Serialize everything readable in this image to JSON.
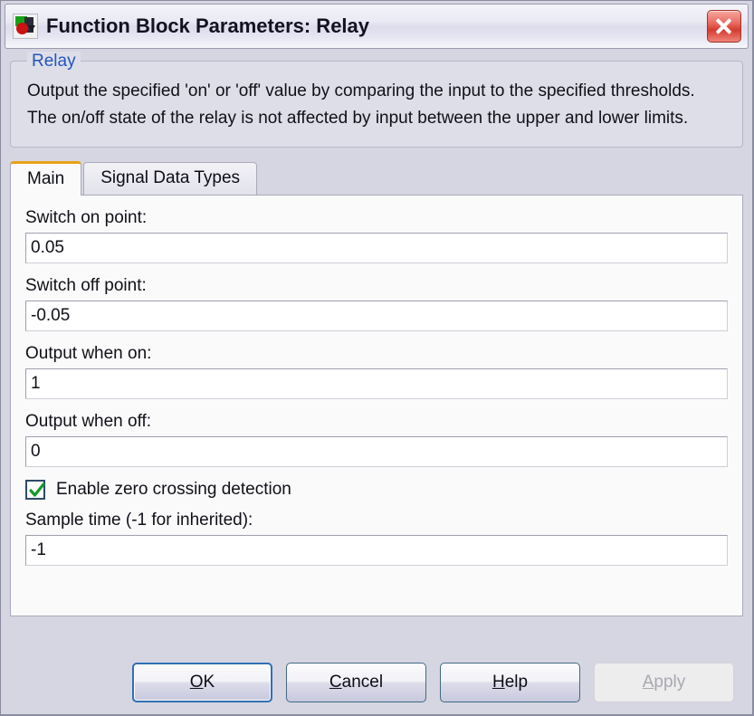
{
  "window": {
    "title": "Function Block Parameters: Relay",
    "icon": "simulink-block-icon",
    "close_label": "close-icon"
  },
  "description_group": {
    "label": "Relay",
    "text": "Output the specified 'on' or 'off' value by comparing the input to the specified thresholds.  The on/off state of the relay is not affected by input between the upper and lower limits."
  },
  "tabs": [
    {
      "label": "Main",
      "active": true
    },
    {
      "label": "Signal Data Types",
      "active": false
    }
  ],
  "fields": [
    {
      "label": "Switch on point:",
      "value": "0.05"
    },
    {
      "label": "Switch off point:",
      "value": "-0.05"
    },
    {
      "label": "Output when on:",
      "value": "1"
    },
    {
      "label": "Output when off:",
      "value": "0"
    }
  ],
  "checkbox": {
    "label": "Enable zero crossing detection",
    "checked": true
  },
  "sample_time": {
    "label": "Sample time (-1 for inherited):",
    "value": "-1"
  },
  "buttons": [
    {
      "label": "OK",
      "mnemonic": "O",
      "rest": "K",
      "pre": "",
      "state": "default"
    },
    {
      "label": "Cancel",
      "mnemonic": "C",
      "rest": "ancel",
      "pre": "",
      "state": "normal"
    },
    {
      "label": "Help",
      "mnemonic": "H",
      "rest": "elp",
      "pre": "",
      "state": "normal"
    },
    {
      "label": "Apply",
      "mnemonic": "A",
      "rest": "pply",
      "pre": "",
      "state": "disabled"
    }
  ],
  "colors": {
    "dialog_bg": "#d6d6e2",
    "group_bg": "#dedee9",
    "panel_bg": "#fafafa",
    "group_label": "#2255bb",
    "active_tab_accent": "#e8a317",
    "close_red": "#d63b30",
    "check_green": "#17992b",
    "default_button_border": "#2f6fb5"
  }
}
